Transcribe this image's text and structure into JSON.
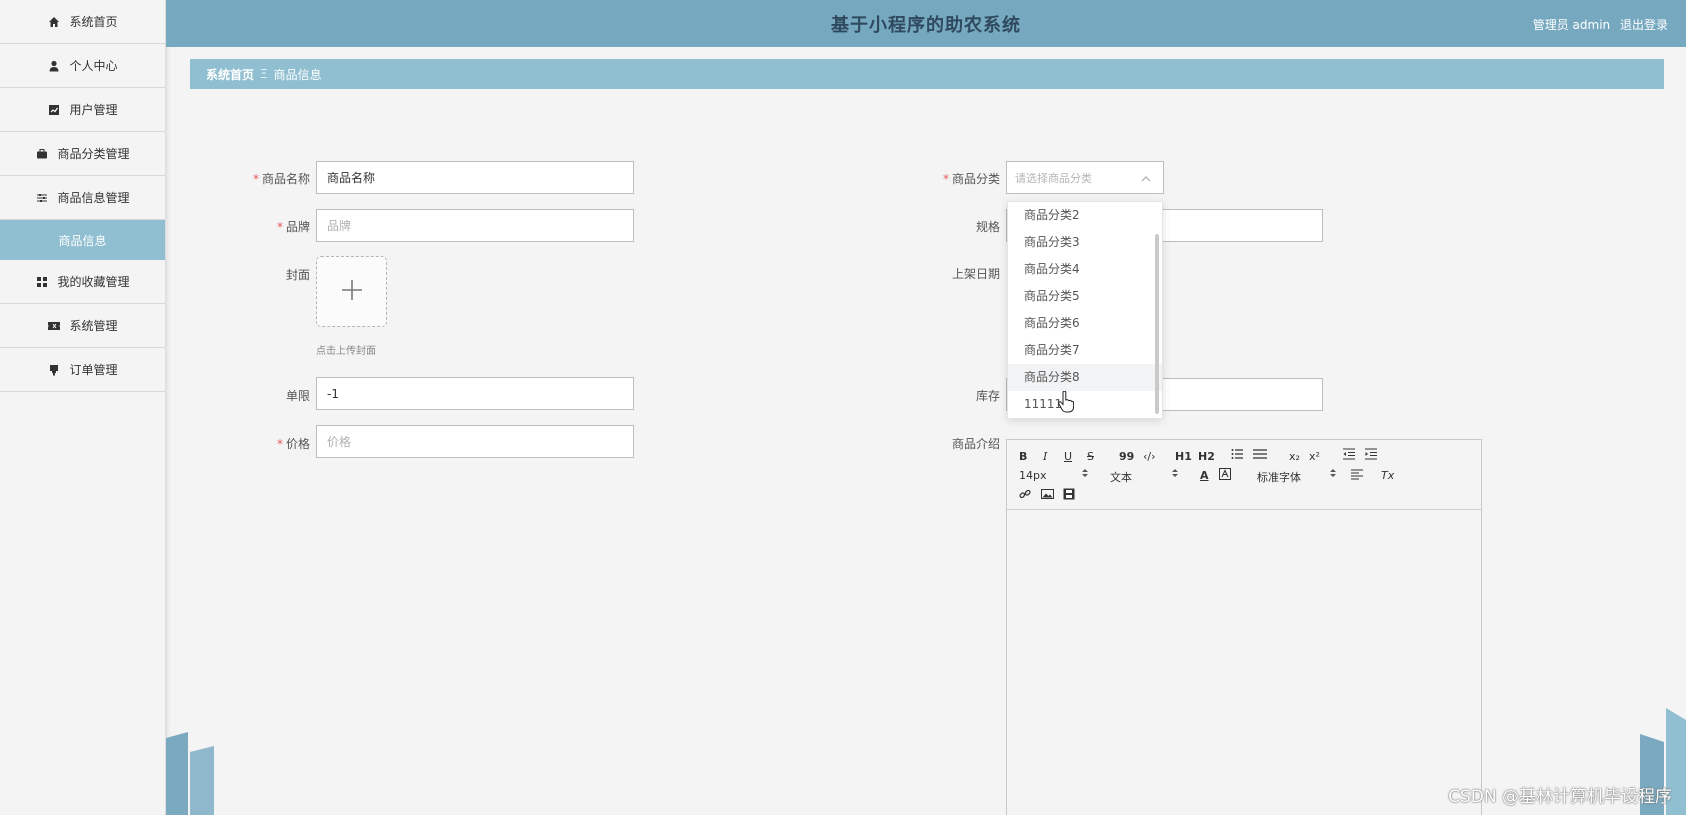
{
  "header": {
    "title": "基于小程序的助农系统",
    "user_label": "管理员 admin",
    "logout": "退出登录"
  },
  "sidebar": {
    "items": [
      {
        "label": "系统首页",
        "icon": "home-icon"
      },
      {
        "label": "个人中心",
        "icon": "user-icon"
      },
      {
        "label": "用户管理",
        "icon": "chart-icon"
      },
      {
        "label": "商品分类管理",
        "icon": "briefcase-icon"
      },
      {
        "label": "商品信息管理",
        "icon": "sliders-icon"
      },
      {
        "label": "商品信息",
        "icon": ""
      },
      {
        "label": "我的收藏管理",
        "icon": "grid-icon"
      },
      {
        "label": "系统管理",
        "icon": "ticket-icon"
      },
      {
        "label": "订单管理",
        "icon": "cart-icon"
      }
    ]
  },
  "breadcrumb": {
    "home": "系统首页",
    "separator": "Ξ",
    "current": "商品信息"
  },
  "form": {
    "name": {
      "label": "商品名称",
      "value": "商品名称"
    },
    "brand": {
      "label": "品牌",
      "placeholder": "品牌"
    },
    "cover": {
      "label": "封面",
      "tip": "点击上传封面"
    },
    "limit": {
      "label": "单限",
      "value": "-1"
    },
    "price": {
      "label": "价格",
      "placeholder": "价格"
    },
    "category": {
      "label": "商品分类",
      "placeholder": "请选择商品分类"
    },
    "spec": {
      "label": "规格"
    },
    "date": {
      "label": "上架日期"
    },
    "stock": {
      "label": "库存"
    },
    "intro": {
      "label": "商品介绍"
    }
  },
  "dropdown": {
    "options": [
      "商品分类2",
      "商品分类3",
      "商品分类4",
      "商品分类5",
      "商品分类6",
      "商品分类7",
      "商品分类8",
      "11111"
    ],
    "hovered_index": 6
  },
  "editor": {
    "font_size": "14px",
    "text_type": "文本",
    "font_family": "标准字体",
    "bold": "B",
    "italic": "I",
    "underline": "U",
    "strike": "S",
    "quote": "99",
    "code": "‹/›",
    "h1": "H1",
    "h2": "H2",
    "sub": "x₂",
    "sup": "x²",
    "font_color": "A",
    "clear": "Tx"
  },
  "watermark": "CSDN @基林计算机毕设程序",
  "colors": {
    "header_bg": "#76a8c0",
    "accent": "#8fbfd0",
    "required": "#e25b5b"
  }
}
